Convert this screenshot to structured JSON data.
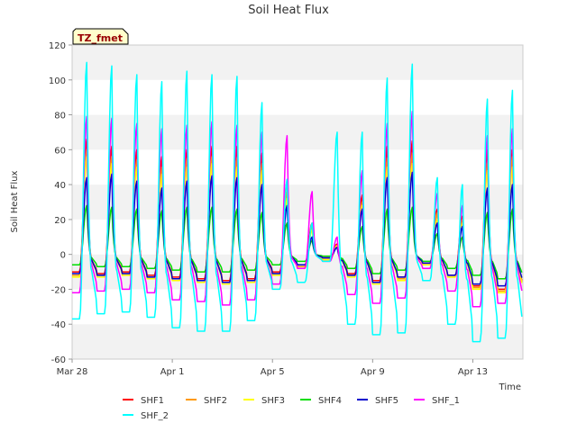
{
  "chart_data": {
    "type": "line",
    "title": "Soil Heat Flux",
    "xlabel": "Time",
    "ylabel": "Soil Heat Flux",
    "site_tag": "TZ_fmet",
    "x_range": [
      "2000-03-28",
      "2000-04-15"
    ],
    "x_ticks": [
      {
        "date": "2000-03-28",
        "label": "Mar 28"
      },
      {
        "date": "2000-04-01",
        "label": "Apr 1"
      },
      {
        "date": "2000-04-05",
        "label": "Apr 5"
      },
      {
        "date": "2000-04-09",
        "label": "Apr 9"
      },
      {
        "date": "2000-04-13",
        "label": "Apr 13"
      }
    ],
    "ylim": [
      -60,
      120
    ],
    "y_ticks": [
      -60,
      -40,
      -20,
      0,
      20,
      40,
      60,
      80,
      100,
      120
    ],
    "grid": "horizontal bands",
    "legend_position": "bottom",
    "days": [
      "2000-03-28",
      "2000-03-29",
      "2000-03-30",
      "2000-03-31",
      "2000-04-01",
      "2000-04-02",
      "2000-04-03",
      "2000-04-04",
      "2000-04-05",
      "2000-04-06",
      "2000-04-07",
      "2000-04-08",
      "2000-04-09",
      "2000-04-10",
      "2000-04-11",
      "2000-04-12",
      "2000-04-13",
      "2000-04-14"
    ],
    "series": [
      {
        "name": "SHF1",
        "color": "#ff0000",
        "peaks": [
          66,
          62,
          60,
          56,
          60,
          62,
          62,
          58,
          42,
          18,
          6,
          34,
          62,
          65,
          26,
          22,
          60,
          60
        ],
        "troughs": [
          -10,
          -11,
          -10,
          -12,
          -13,
          -14,
          -15,
          -14,
          -10,
          -6,
          -2,
          -11,
          -15,
          -13,
          -5,
          -12,
          -18,
          -20
        ]
      },
      {
        "name": "SHF2",
        "color": "#ff9900",
        "peaks": [
          60,
          56,
          54,
          50,
          55,
          56,
          55,
          52,
          36,
          16,
          5,
          30,
          55,
          58,
          24,
          20,
          52,
          56
        ],
        "troughs": [
          -12,
          -12,
          -11,
          -13,
          -14,
          -15,
          -16,
          -15,
          -11,
          -7,
          -3,
          -12,
          -16,
          -14,
          -6,
          -13,
          -19,
          -21
        ]
      },
      {
        "name": "SHF3",
        "color": "#ffff00",
        "peaks": [
          56,
          52,
          50,
          46,
          50,
          52,
          50,
          48,
          32,
          14,
          5,
          28,
          50,
          52,
          20,
          18,
          48,
          50
        ],
        "troughs": [
          -13,
          -13,
          -12,
          -14,
          -15,
          -16,
          -17,
          -16,
          -12,
          -8,
          -3,
          -13,
          -17,
          -15,
          -6,
          -13,
          -20,
          -22
        ]
      },
      {
        "name": "SHF4",
        "color": "#00dd00",
        "peaks": [
          28,
          27,
          26,
          25,
          27,
          27,
          26,
          24,
          18,
          8,
          4,
          16,
          26,
          27,
          12,
          10,
          24,
          26
        ],
        "troughs": [
          -6,
          -7,
          -7,
          -8,
          -9,
          -10,
          -10,
          -9,
          -6,
          -4,
          -1,
          -8,
          -11,
          -9,
          -4,
          -8,
          -12,
          -14
        ]
      },
      {
        "name": "SHF5",
        "color": "#0000cc",
        "peaks": [
          44,
          46,
          42,
          38,
          42,
          45,
          44,
          40,
          28,
          10,
          4,
          26,
          44,
          47,
          18,
          16,
          38,
          40
        ],
        "troughs": [
          -11,
          -12,
          -11,
          -13,
          -14,
          -15,
          -16,
          -15,
          -11,
          -6,
          -2,
          -12,
          -16,
          -13,
          -5,
          -12,
          -17,
          -18
        ]
      },
      {
        "name": "SHF_1",
        "color": "#ff00ff",
        "peaks": [
          79,
          78,
          75,
          72,
          74,
          76,
          74,
          70,
          68,
          36,
          10,
          48,
          75,
          82,
          35,
          28,
          68,
          72
        ],
        "troughs": [
          -22,
          -21,
          -20,
          -22,
          -26,
          -27,
          -29,
          -26,
          -17,
          -8,
          -4,
          -23,
          -28,
          -25,
          -8,
          -21,
          -30,
          -28
        ]
      },
      {
        "name": "SHF_2",
        "color": "#00ffff",
        "peaks": [
          110,
          108,
          103,
          99,
          105,
          103,
          102,
          87,
          43,
          18,
          70,
          70,
          101,
          109,
          44,
          40,
          89,
          94
        ],
        "troughs": [
          -37,
          -34,
          -33,
          -36,
          -42,
          -44,
          -44,
          -38,
          -20,
          -16,
          -4,
          -40,
          -46,
          -45,
          -15,
          -40,
          -50,
          -48
        ]
      }
    ]
  }
}
